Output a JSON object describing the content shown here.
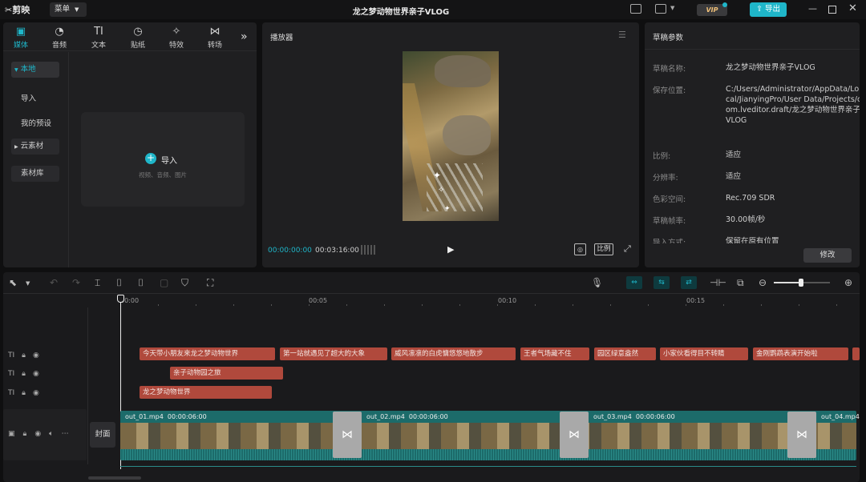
{
  "app": {
    "logo_text": "剪映",
    "menu_label": "菜单",
    "title": "龙之梦动物世界亲子VLOG",
    "vip_label": "VIP",
    "export_label": "导出"
  },
  "tabs": [
    {
      "label": "媒体",
      "icon": "media-icon"
    },
    {
      "label": "音频",
      "icon": "audio-icon"
    },
    {
      "label": "文本",
      "icon": "text-icon"
    },
    {
      "label": "贴纸",
      "icon": "sticker-icon"
    },
    {
      "label": "特效",
      "icon": "effects-icon"
    },
    {
      "label": "转场",
      "icon": "transition-icon"
    }
  ],
  "sidebar": {
    "items": [
      "本地",
      "导入",
      "我的预设",
      "云素材",
      "素材库"
    ]
  },
  "media": {
    "import_label": "导入",
    "import_hint": "视频、音频、图片"
  },
  "player": {
    "title": "播放器",
    "current_time": "00:00:00:00",
    "total_time": "00:03:16:00",
    "ratio_label": "比例"
  },
  "draft": {
    "title": "草稿参数",
    "rows": [
      {
        "k": "草稿名称:",
        "v": "龙之梦动物世界亲子VLOG"
      },
      {
        "k": "保存位置:",
        "v": "C:/Users/Administrator/AppData/Local/JianyingPro/User Data/Projects/com.lveditor.draft/龙之梦动物世界亲子VLOG"
      },
      {
        "k": "比例:",
        "v": "适应"
      },
      {
        "k": "分辨率:",
        "v": "适应"
      },
      {
        "k": "色彩空间:",
        "v": "Rec.709 SDR"
      },
      {
        "k": "草稿帧率:",
        "v": "30.00帧/秒"
      },
      {
        "k": "导入方式:",
        "v": "保留在原有位置"
      }
    ],
    "edit_label": "修改"
  },
  "ruler": [
    "00:00",
    "00:05",
    "00:10",
    "00:15"
  ],
  "text_tracks": [
    {
      "clips": [
        {
          "text": "今天带小朋友来龙之梦动物世界"
        },
        {
          "text": "第一站就遇见了超大的大象"
        },
        {
          "text": "威风凛凛的白虎慵悠悠地散步"
        },
        {
          "text": "王者气场藏不住"
        },
        {
          "text": "园区绿意盎然"
        },
        {
          "text": "小家伙看得目不转睛"
        },
        {
          "text": "金刚鹦鹉表演开始啦"
        }
      ]
    },
    {
      "clips": [
        {
          "text": "亲子动物园之旅"
        }
      ]
    },
    {
      "clips": [
        {
          "text": "龙之梦动物世界"
        }
      ]
    }
  ],
  "video_track": {
    "cover_label": "封面",
    "clips": [
      {
        "name": "out_01.mp4",
        "duration": "00:00:06:00"
      },
      {
        "name": "out_02.mp4",
        "duration": "00:00:06:00"
      },
      {
        "name": "out_03.mp4",
        "duration": "00:00:06:00"
      },
      {
        "name": "out_04.mp4",
        "duration": ""
      }
    ]
  },
  "colors": {
    "accent": "#1fb6c9",
    "text_clip": "#b0493c",
    "video_clip": "#1c6b6a"
  }
}
